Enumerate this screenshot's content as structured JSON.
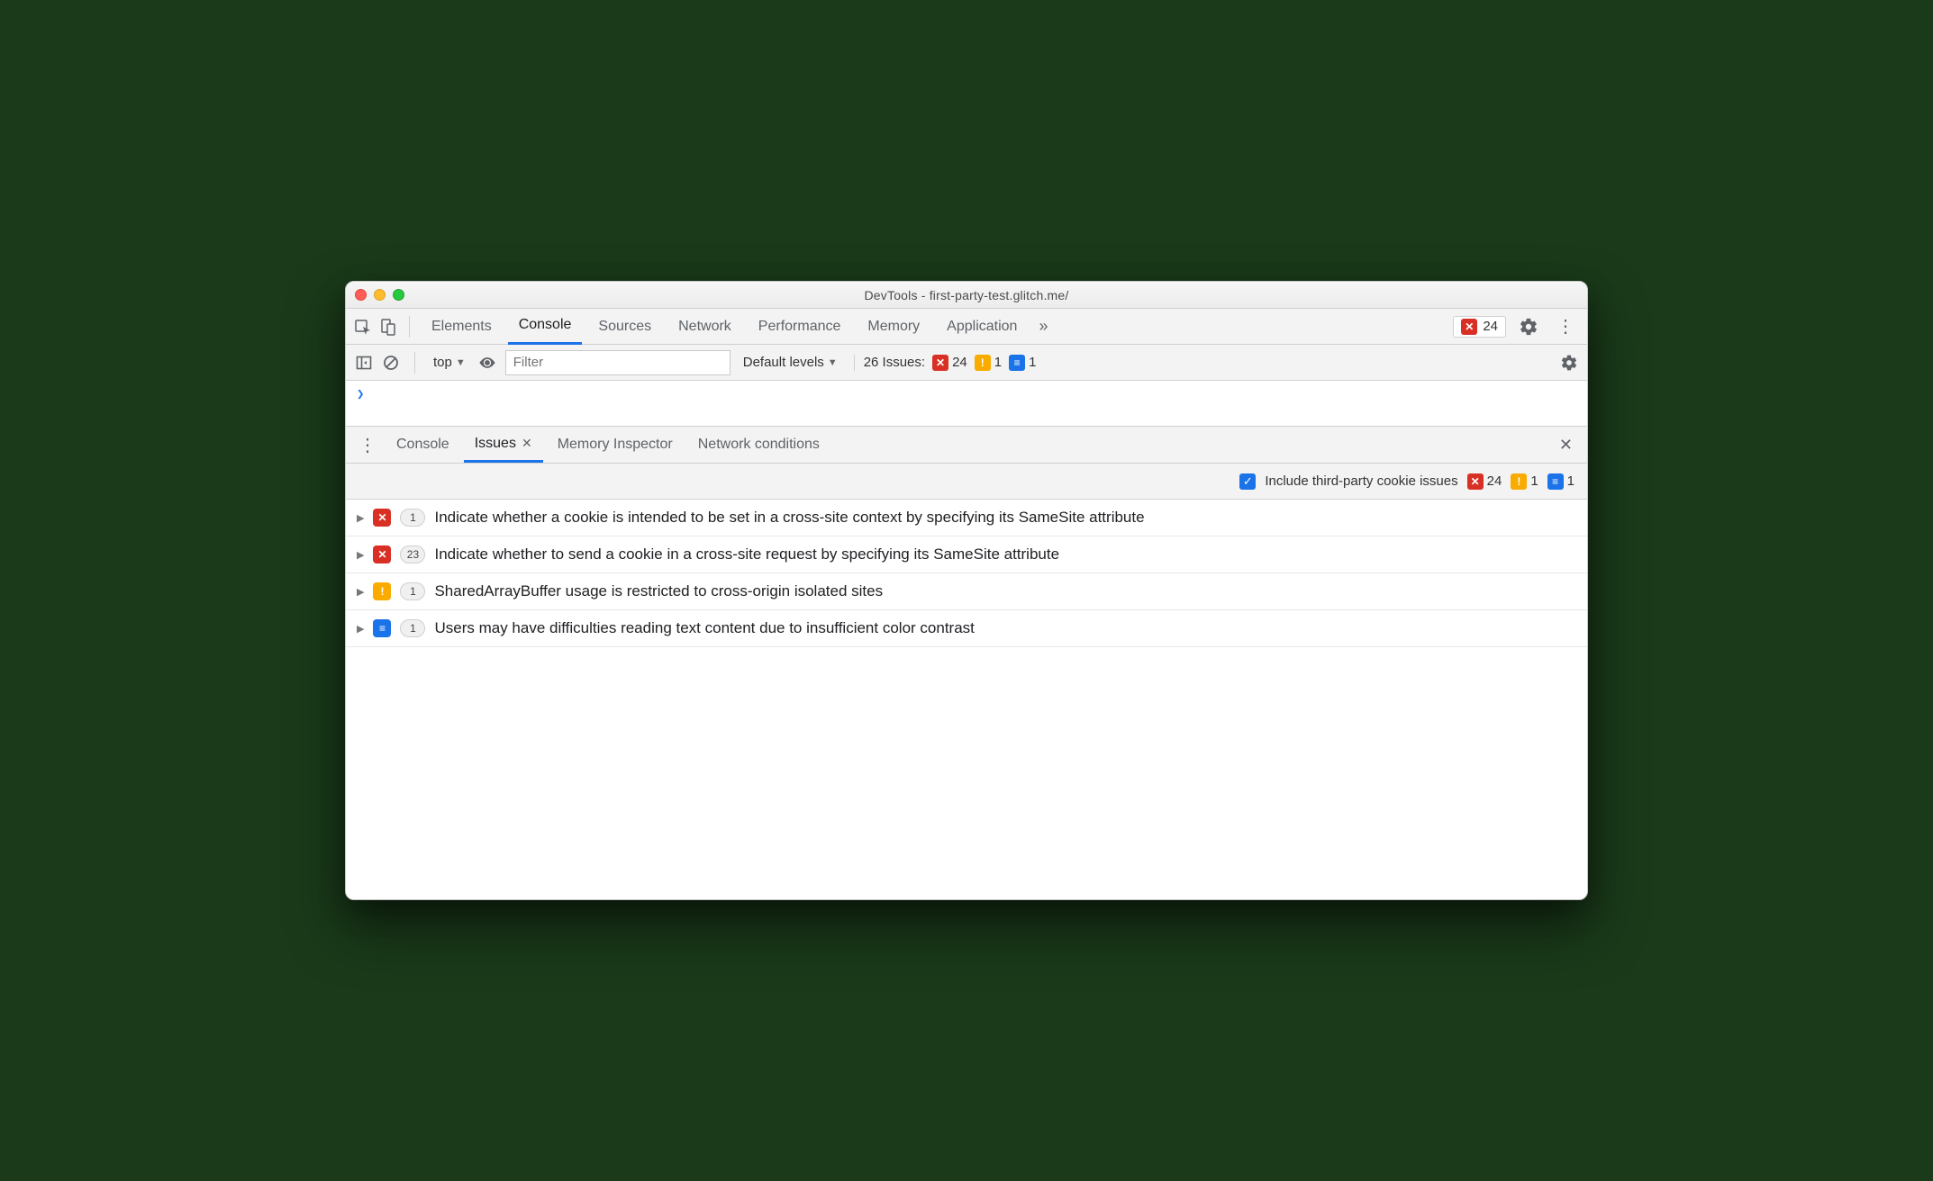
{
  "window": {
    "title": "DevTools - first-party-test.glitch.me/"
  },
  "tabs": {
    "items": [
      "Elements",
      "Console",
      "Sources",
      "Network",
      "Performance",
      "Memory",
      "Application"
    ],
    "active": "Console",
    "overflow": "»"
  },
  "topbar_issues": {
    "error_count": "24"
  },
  "console_toolbar": {
    "context": "top",
    "filter_placeholder": "Filter",
    "levels": "Default levels",
    "issues_label": "26 Issues:",
    "counts": {
      "error": "24",
      "warn": "1",
      "info": "1"
    }
  },
  "drawer": {
    "tabs": [
      {
        "label": "Console",
        "active": false,
        "has_close": false
      },
      {
        "label": "Issues",
        "active": true,
        "has_close": true
      },
      {
        "label": "Memory Inspector",
        "active": false,
        "has_close": false
      },
      {
        "label": "Network conditions",
        "active": false,
        "has_close": false
      }
    ]
  },
  "issues_filter": {
    "checkbox_label": "Include third-party cookie issues",
    "counts": {
      "error": "24",
      "warn": "1",
      "info": "1"
    }
  },
  "issues": [
    {
      "severity": "error",
      "count": "1",
      "title": "Indicate whether a cookie is intended to be set in a cross-site context by specifying its SameSite attribute"
    },
    {
      "severity": "error",
      "count": "23",
      "title": "Indicate whether to send a cookie in a cross-site request by specifying its SameSite attribute"
    },
    {
      "severity": "warn",
      "count": "1",
      "title": "SharedArrayBuffer usage is restricted to cross-origin isolated sites"
    },
    {
      "severity": "info",
      "count": "1",
      "title": "Users may have difficulties reading text content due to insufficient color contrast"
    }
  ]
}
